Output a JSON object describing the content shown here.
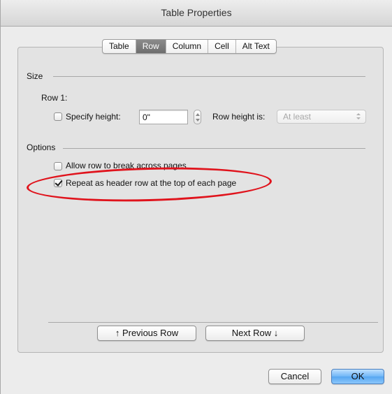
{
  "window": {
    "title": "Table Properties"
  },
  "tabs": [
    {
      "label": "Table",
      "active": false
    },
    {
      "label": "Row",
      "active": true
    },
    {
      "label": "Column",
      "active": false
    },
    {
      "label": "Cell",
      "active": false
    },
    {
      "label": "Alt Text",
      "active": false
    }
  ],
  "size": {
    "section_label": "Size",
    "row_label": "Row 1:",
    "specify_height": {
      "label": "Specify height:",
      "checked": false
    },
    "height_value": "0\"",
    "row_height_label": "Row height is:",
    "row_height_select": {
      "value": "At least",
      "enabled": false
    }
  },
  "options": {
    "section_label": "Options",
    "allow_break": {
      "label": "Allow row to break across pages",
      "checked": false
    },
    "repeat_header": {
      "label": "Repeat as header row at the top of each page",
      "checked": true
    }
  },
  "nav": {
    "previous_row": "↑  Previous Row",
    "next_row": "Next Row  ↓"
  },
  "footer": {
    "cancel": "Cancel",
    "ok": "OK"
  },
  "annotation": {
    "color": "#e0131c"
  }
}
